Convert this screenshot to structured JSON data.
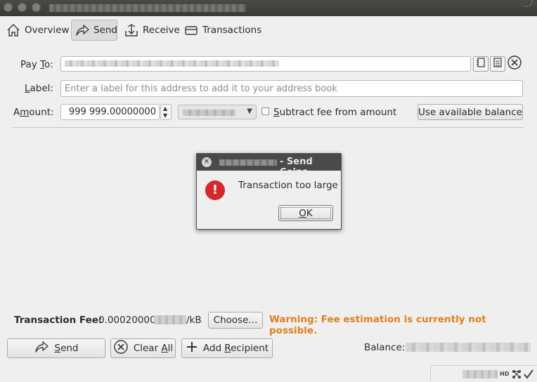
{
  "tabs": [
    {
      "label": "Overview",
      "icon": "home-icon",
      "active": false
    },
    {
      "label": "Send",
      "icon": "send-icon",
      "active": true
    },
    {
      "label": "Receive",
      "icon": "receive-icon",
      "active": false
    },
    {
      "label": "Transactions",
      "icon": "transactions-icon",
      "active": false
    }
  ],
  "form": {
    "payto_prefix": "Pay ",
    "payto_mnemonic": "T",
    "payto_suffix": "o:",
    "payto_value": "",
    "label_mnemonic": "L",
    "label_rest": "abel:",
    "label_placeholder": "Enter a label for this address to add it to your address book",
    "amount_prefix": "A",
    "amount_mnemonic": "m",
    "amount_suffix": "ount:",
    "amount_value": "999 999.00000000",
    "subtract_fee_mnemonic": "S",
    "subtract_fee_rest": "ubtract fee from amount",
    "subtract_fee_checked": false,
    "use_balance_label": "Use available balance"
  },
  "dialog": {
    "title": "- Send Coins",
    "message": "Transaction too large",
    "ok_mnemonic": "O",
    "ok_rest": "K",
    "icon": "error-icon"
  },
  "fee": {
    "label": "Transaction Fee:",
    "value": "0.00020000",
    "unit_suffix": "/kB",
    "choose_label": "Choose...",
    "warning": "Warning: Fee estimation is currently not possible.",
    "warning_color": "#e2811c"
  },
  "actions": {
    "send_mnemonic": "S",
    "send_rest": "end",
    "clear_prefix": "Clear ",
    "clear_mnemonic": "A",
    "clear_rest": "ll",
    "add_prefix": "Add ",
    "add_mnemonic": "R",
    "add_rest": "ecipient"
  },
  "balance": {
    "label": "Balance:"
  },
  "statusbar": {
    "hd": "HD"
  }
}
